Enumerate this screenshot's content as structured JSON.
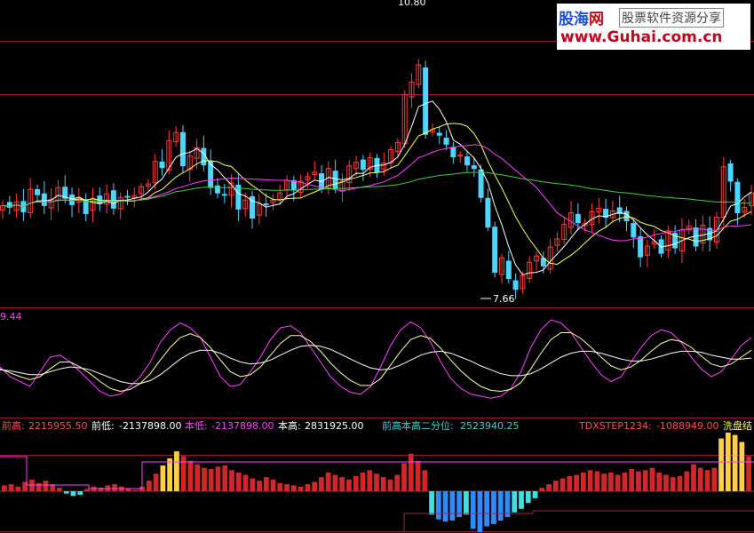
{
  "watermark": {
    "brand_a": "股海",
    "brand_b": "网",
    "tagline": "股票软件资源分享",
    "url": "www.Guhai.com.cn"
  },
  "price_panel": {
    "high_label": "10.80",
    "low_label": "7.66",
    "colors": {
      "up": "#ff3b3b",
      "down": "#4fd4ff",
      "ma5": "#ffffff",
      "ma10": "#ffff66",
      "ma20": "#ff40ff",
      "ma60": "#40d040",
      "grid": "#a0103a"
    }
  },
  "osc_panel": {
    "value_label": "9.44",
    "colors": {
      "fast": "#ff40ff",
      "mid": "#ffffaa",
      "slow": "#ffffff"
    }
  },
  "bottom_header": {
    "prev_high_label": "前高:",
    "prev_high_value": "2215955.50",
    "prev_low_label": "前低:",
    "prev_low_value": "-2137898.00",
    "cur_low_label": "本低:",
    "cur_low_value": "-2137898.00",
    "cur_high_label": "本高:",
    "cur_high_value": "2831925.00",
    "quantile_label": "前高本高二分位:",
    "quantile_value": "2523940.25",
    "step_label": "TDXSTEP1234:",
    "step_value": "-1088949.00",
    "trailing_label": "洗盘结"
  },
  "chart_data": [
    {
      "type": "candlestick",
      "title": "",
      "annotations": [
        "10.80",
        "7.66"
      ],
      "series": [
        {
          "name": "",
          "values": [
            8.62,
            8.6,
            8.66,
            8.55,
            8.8,
            8.74,
            8.62,
            8.69,
            8.82,
            8.7,
            8.63,
            8.71,
            8.53,
            8.7,
            8.64,
            8.75,
            8.59,
            8.71,
            8.72,
            8.73,
            8.83,
            8.86,
            9.11,
            9.04,
            9.34,
            9.43,
            9.06,
            9.17,
            9.26,
            9.07,
            8.82,
            8.76,
            8.74,
            8.87,
            8.58,
            8.68,
            8.48,
            8.64,
            8.63,
            8.68,
            8.76,
            8.9,
            8.79,
            8.89,
            8.94,
            8.99,
            8.81,
            9.03,
            8.81,
            8.89,
            9.06,
            9.1,
            9.02,
            9.15,
            8.99,
            9.09,
            9.24,
            9.32,
            9.85,
            9.99,
            10.18,
            9.41,
            9.46,
            9.4,
            9.3,
            9.16,
            9.18,
            9.07,
            9.03,
            8.71,
            8.38,
            7.88,
            8.04,
            7.81,
            7.69,
            7.84,
            7.99,
            8.06,
            7.95,
            8.16,
            8.25,
            8.41,
            8.54,
            8.43,
            8.42,
            8.55,
            8.59,
            8.49,
            8.56,
            8.53,
            8.45,
            8.27,
            8.05,
            8.17,
            8.22,
            8.09,
            8.34,
            8.15,
            8.35,
            8.39,
            8.17,
            8.4,
            8.24,
            8.49,
            9.05,
            8.89,
            8.54,
            8.6,
            8.76
          ]
        }
      ]
    },
    {
      "type": "line",
      "title": "",
      "series": [
        {
          "name": "",
          "values": [
            50,
            40,
            35,
            30,
            45,
            60,
            62,
            55,
            45,
            35,
            25,
            20,
            22,
            30,
            40,
            55,
            75,
            88,
            95,
            90,
            80,
            60,
            40,
            30,
            32,
            45,
            60,
            78,
            90,
            92,
            85,
            70,
            55,
            40,
            30,
            24,
            22,
            30,
            50,
            72,
            88,
            96,
            90,
            75,
            55,
            38,
            28,
            22,
            20,
            18,
            20,
            28,
            45,
            70,
            88,
            98,
            95,
            85,
            70,
            55,
            42,
            35,
            40,
            55,
            70,
            82,
            88,
            85,
            75,
            60,
            48,
            40,
            45,
            58,
            72,
            80
          ]
        },
        {
          "name": "",
          "values": [
            48,
            44,
            40,
            37,
            40,
            48,
            55,
            55,
            50,
            43,
            35,
            28,
            25,
            27,
            33,
            43,
            57,
            70,
            80,
            84,
            80,
            70,
            57,
            45,
            40,
            42,
            50,
            62,
            74,
            82,
            82,
            76,
            66,
            54,
            44,
            36,
            31,
            31,
            38,
            52,
            66,
            78,
            82,
            79,
            69,
            57,
            46,
            37,
            30,
            26,
            25,
            27,
            34,
            48,
            64,
            78,
            85,
            85,
            79,
            70,
            60,
            51,
            47,
            50,
            57,
            66,
            74,
            78,
            76,
            70,
            61,
            53,
            50,
            53,
            60,
            67
          ]
        },
        {
          "name": "",
          "values": [
            47,
            46,
            44,
            42,
            42,
            45,
            48,
            50,
            49,
            47,
            43,
            39,
            35,
            33,
            33,
            36,
            42,
            50,
            58,
            64,
            67,
            67,
            64,
            59,
            55,
            53,
            54,
            57,
            62,
            67,
            71,
            72,
            71,
            68,
            63,
            58,
            53,
            49,
            47,
            48,
            52,
            57,
            62,
            65,
            66,
            64,
            60,
            56,
            51,
            47,
            43,
            41,
            41,
            43,
            48,
            54,
            60,
            64,
            66,
            66,
            64,
            61,
            58,
            56,
            56,
            58,
            61,
            64,
            66,
            66,
            65,
            62,
            60,
            58,
            58,
            59
          ]
        }
      ]
    },
    {
      "type": "bar",
      "title": "",
      "values": [
        0.5,
        0.6,
        0.4,
        0.8,
        1.0,
        0.7,
        0.9,
        0.6,
        0.3,
        -0.2,
        -0.4,
        -0.3,
        0.2,
        0.4,
        0.3,
        0.5,
        0.6,
        0.4,
        0.2,
        0.1,
        0.4,
        0.9,
        1.5,
        2.2,
        2.8,
        3.4,
        3.0,
        2.6,
        2.3,
        2.0,
        1.9,
        2.1,
        2.2,
        1.8,
        1.6,
        1.4,
        1.1,
        0.9,
        1.2,
        1.0,
        0.7,
        0.6,
        0.5,
        0.4,
        0.6,
        0.8,
        1.2,
        1.6,
        1.4,
        1.2,
        1.0,
        1.3,
        1.6,
        1.8,
        1.5,
        1.2,
        1.0,
        1.4,
        2.4,
        3.2,
        2.6,
        1.8,
        -2.0,
        -2.4,
        -2.6,
        -2.5,
        -2.2,
        -2.0,
        -3.2,
        -3.5,
        -3.0,
        -2.8,
        -2.5,
        -2.2,
        -1.8,
        -1.5,
        -1.0,
        -0.6,
        0.3,
        0.6,
        0.9,
        1.1,
        1.3,
        1.4,
        1.6,
        1.8,
        1.7,
        1.5,
        1.6,
        1.4,
        1.6,
        1.9,
        1.7,
        1.8,
        2.0,
        1.6,
        1.4,
        1.2,
        1.3,
        1.7,
        2.3,
        2.0,
        1.8,
        2.0,
        4.5,
        5.0,
        4.8,
        4.2,
        3.0
      ],
      "ylim": [
        -4,
        6
      ]
    }
  ]
}
